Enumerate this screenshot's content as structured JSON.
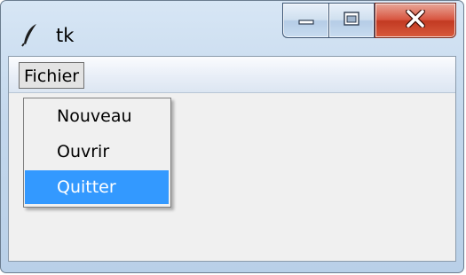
{
  "window": {
    "title": "tk",
    "icon": "feather-icon",
    "caption_buttons": [
      "minimize-icon",
      "maximize-icon",
      "close-icon"
    ]
  },
  "menubar": {
    "items": [
      {
        "label": "Fichier",
        "active": true
      }
    ]
  },
  "dropdown": {
    "items": [
      {
        "label": "Nouveau",
        "selected": false
      },
      {
        "label": "Ouvrir",
        "selected": false
      },
      {
        "label": "Quitter",
        "selected": true
      }
    ]
  },
  "colors": {
    "selection": "#3399ff",
    "client_bg": "#f0f0f0",
    "close_button": "#c9452e"
  }
}
